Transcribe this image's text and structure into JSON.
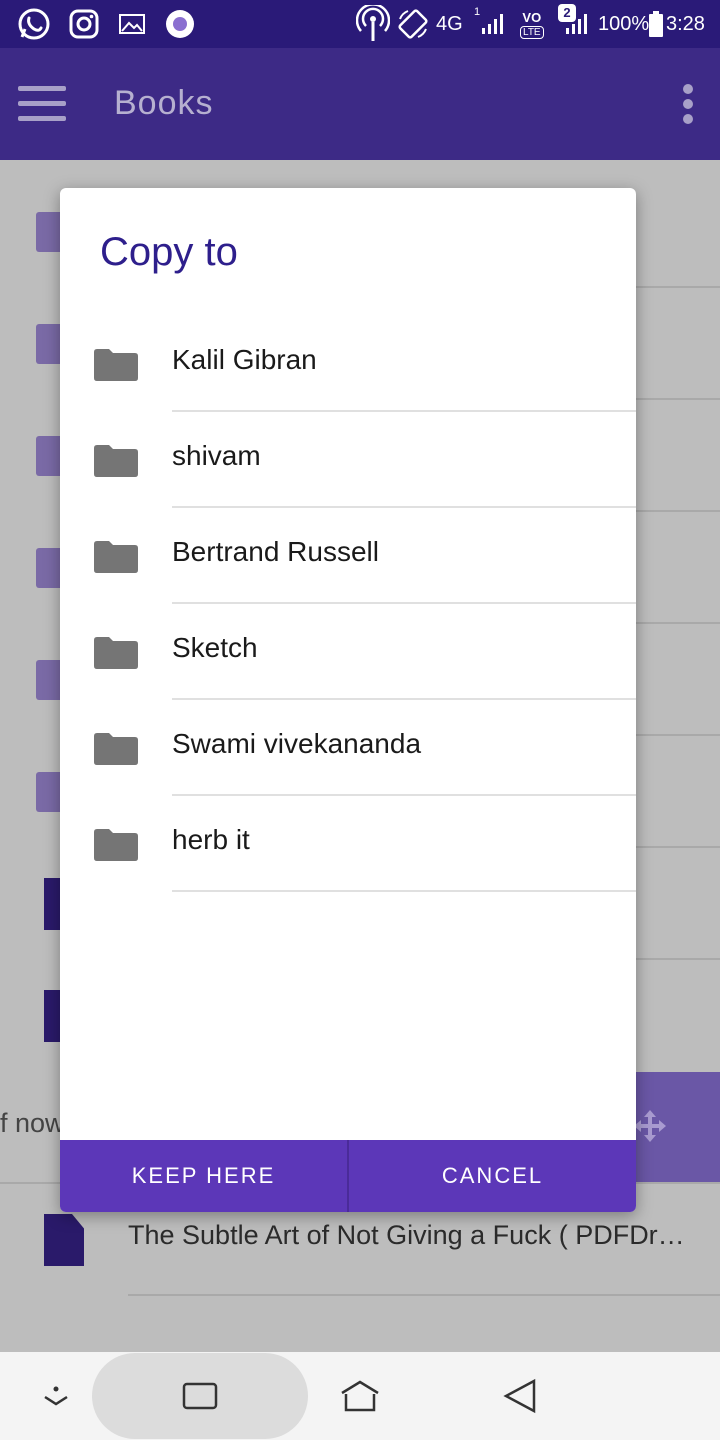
{
  "status_bar": {
    "network": "4G",
    "sim1_label": "1",
    "sim2_label": "2",
    "volte_label": "VO",
    "lte_label": "LTE",
    "battery": "100%",
    "battery_level": 1.0,
    "time": "3:28",
    "icons": [
      "whatsapp-icon",
      "instagram-icon",
      "gallery-icon",
      "record-icon",
      "hotspot-icon",
      "rotate-icon",
      "signal-icon",
      "battery-icon"
    ]
  },
  "app_bar": {
    "title": "Books",
    "icons": [
      "menu-icon",
      "overflow-icon"
    ]
  },
  "background": {
    "partial_text": "f now",
    "last_row_text": "The Subtle Art of Not Giving a Fuck ( PDFDr…"
  },
  "dialog": {
    "title": "Copy to",
    "folders": [
      {
        "name": "Kalil Gibran"
      },
      {
        "name": "shivam"
      },
      {
        "name": "Bertrand Russell"
      },
      {
        "name": "Sketch"
      },
      {
        "name": "Swami vivekananda"
      },
      {
        "name": "herb it"
      }
    ],
    "keep_here_label": "KEEP HERE",
    "cancel_label": "CANCEL"
  },
  "colors": {
    "status_bar": "#2a1a78",
    "app_bar": "#3d2a86",
    "accent": "#5c37b8",
    "dialog_title": "#2e1f8c",
    "folder_icon": "#757575"
  },
  "nav_bar": {
    "icons": [
      "keyboard-hide-icon",
      "recents-icon",
      "home-icon",
      "back-icon"
    ]
  }
}
